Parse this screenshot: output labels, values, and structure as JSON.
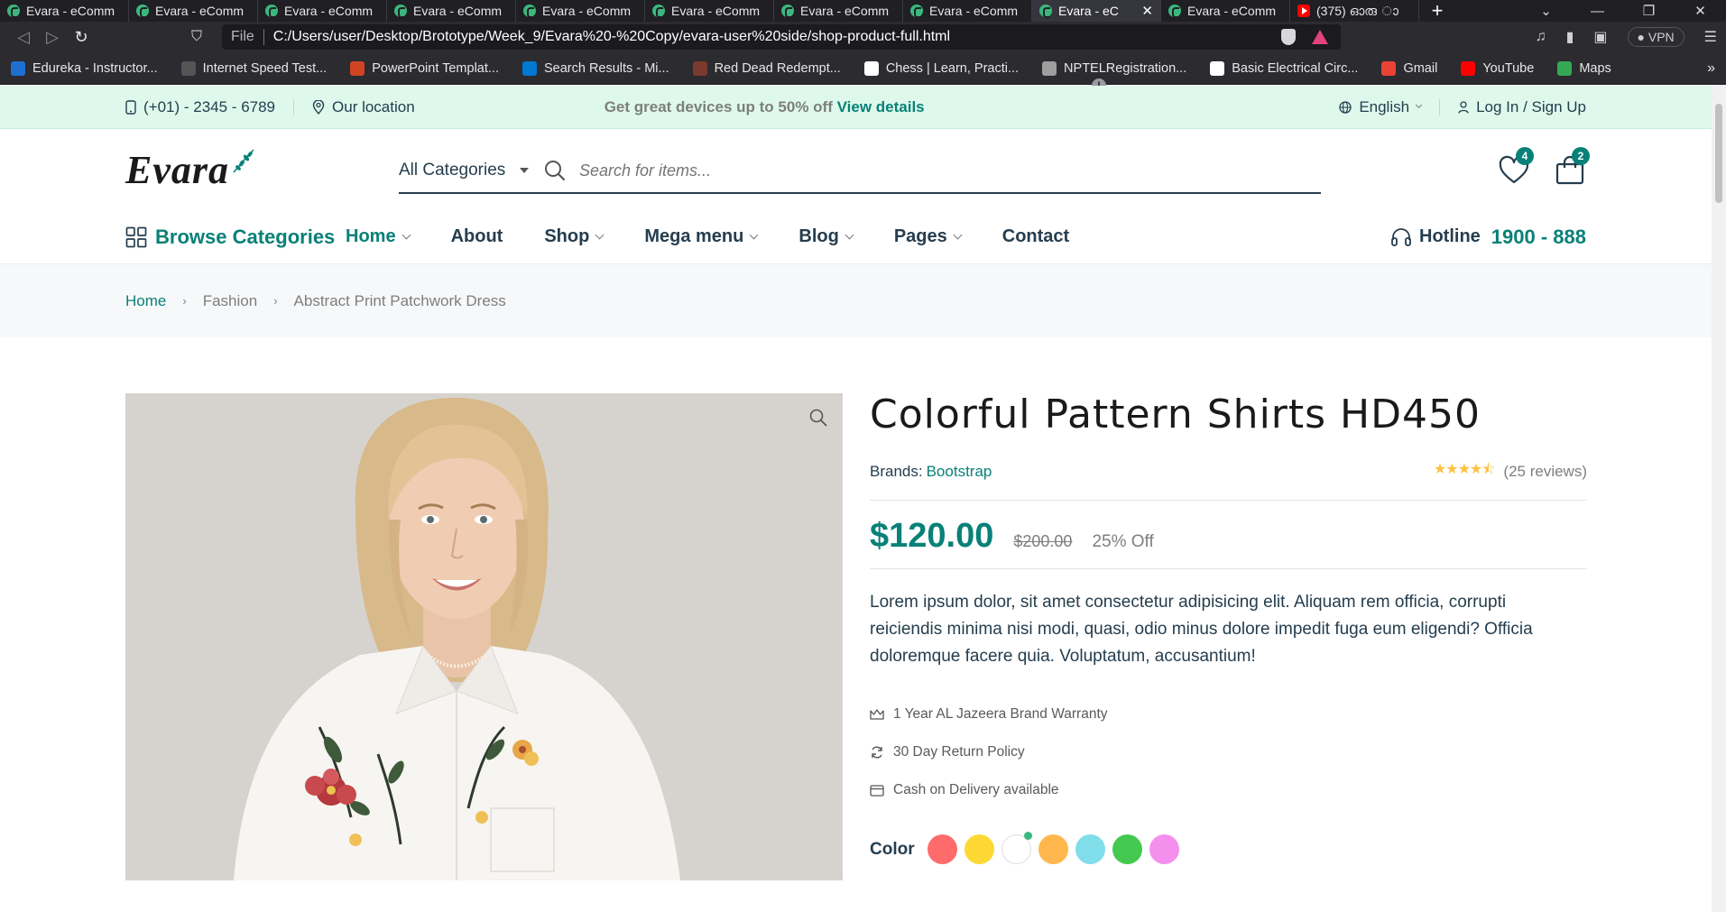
{
  "browser": {
    "tabs": [
      {
        "title": "Evara - eComm",
        "active": false,
        "icon": "evara"
      },
      {
        "title": "Evara - eComm",
        "active": false,
        "icon": "evara"
      },
      {
        "title": "Evara - eComm",
        "active": false,
        "icon": "evara"
      },
      {
        "title": "Evara - eComm",
        "active": false,
        "icon": "evara"
      },
      {
        "title": "Evara - eComm",
        "active": false,
        "icon": "evara"
      },
      {
        "title": "Evara - eComm",
        "active": false,
        "icon": "evara"
      },
      {
        "title": "Evara - eComm",
        "active": false,
        "icon": "evara"
      },
      {
        "title": "Evara - eComm",
        "active": false,
        "icon": "evara"
      },
      {
        "title": "Evara - eC",
        "active": true,
        "icon": "evara"
      },
      {
        "title": "Evara - eComm",
        "active": false,
        "icon": "evara"
      },
      {
        "title": "(375) ഓരു ാ",
        "active": false,
        "icon": "youtube"
      }
    ],
    "new_tab": "+",
    "url_scheme": "File",
    "url": "C:/Users/user/Desktop/Brototype/Week_9/Evara%20-%20Copy/evara-user%20side/shop-product-full.html",
    "vpn_label": "VPN",
    "bookmarks": [
      {
        "label": "Edureka - Instructor...",
        "color": "#1f6fd1"
      },
      {
        "label": "Internet Speed Test...",
        "color": "#555555"
      },
      {
        "label": "PowerPoint Templat...",
        "color": "#d04423"
      },
      {
        "label": "Search Results - Mi...",
        "color": "#0078d4"
      },
      {
        "label": "Red Dead Redempt...",
        "color": "#7a3b2e"
      },
      {
        "label": "Chess | Learn, Practi...",
        "color": "#ffffff"
      },
      {
        "label": "NPTELRegistration...",
        "color": "#9e9e9e"
      },
      {
        "label": "Basic Electrical Circ...",
        "color": "#ffffff"
      },
      {
        "label": "Gmail",
        "color": "#ea4335"
      },
      {
        "label": "YouTube",
        "color": "#ff0000"
      },
      {
        "label": "Maps",
        "color": "#34a853"
      }
    ],
    "bookmarks_more": "»"
  },
  "topbar": {
    "phone": "(+01) - 2345 - 6789",
    "location": "Our location",
    "promo_text": "Get great devices up to 50% off",
    "promo_link": "View details",
    "language": "English",
    "auth": "Log In / Sign Up"
  },
  "header": {
    "logo": "Evara",
    "category_select": "All Categories",
    "search_placeholder": "Search for items...",
    "wishlist_count": "4",
    "cart_count": "2"
  },
  "nav": {
    "browse": "Browse Categories",
    "items": [
      {
        "label": "Home",
        "dropdown": true,
        "active": true
      },
      {
        "label": "About",
        "dropdown": false,
        "active": false
      },
      {
        "label": "Shop",
        "dropdown": true,
        "active": false
      },
      {
        "label": "Mega menu",
        "dropdown": true,
        "active": false
      },
      {
        "label": "Blog",
        "dropdown": true,
        "active": false
      },
      {
        "label": "Pages",
        "dropdown": true,
        "active": false
      },
      {
        "label": "Contact",
        "dropdown": false,
        "active": false
      }
    ],
    "hotline_label": "Hotline",
    "hotline_number": "1900 - 888"
  },
  "breadcrumb": {
    "home": "Home",
    "category": "Fashion",
    "current": "Abstract Print Patchwork Dress",
    "separator": "›"
  },
  "product": {
    "title": "Colorful Pattern Shirts HD450",
    "brand_label": "Brands:",
    "brand": "Bootstrap",
    "rating": 4.5,
    "reviews": "(25 reviews)",
    "price": "$120.00",
    "old_price": "$200.00",
    "discount": "25% Off",
    "description": "Lorem ipsum dolor, sit amet consectetur adipisicing elit. Aliquam rem officia, corrupti reiciendis minima nisi modi, quasi, odio minus dolore impedit fuga eum eligendi? Officia doloremque facere quia. Voluptatum, accusantium!",
    "features": [
      {
        "icon": "crown-icon",
        "text": "1 Year AL Jazeera Brand Warranty"
      },
      {
        "icon": "refresh-icon",
        "text": "30 Day Return Policy"
      },
      {
        "icon": "card-icon",
        "text": "Cash on Delivery available"
      }
    ],
    "color_label": "Color",
    "colors": [
      "#ff6b6b",
      "#fdd835",
      "#ffffff",
      "#ffb74d",
      "#80deea",
      "#43c94f",
      "#f48fed"
    ],
    "selected_color_index": 2
  },
  "colors": {
    "brand": "#088178",
    "topbar_bg": "#def9ec",
    "star": "#fdc040"
  }
}
